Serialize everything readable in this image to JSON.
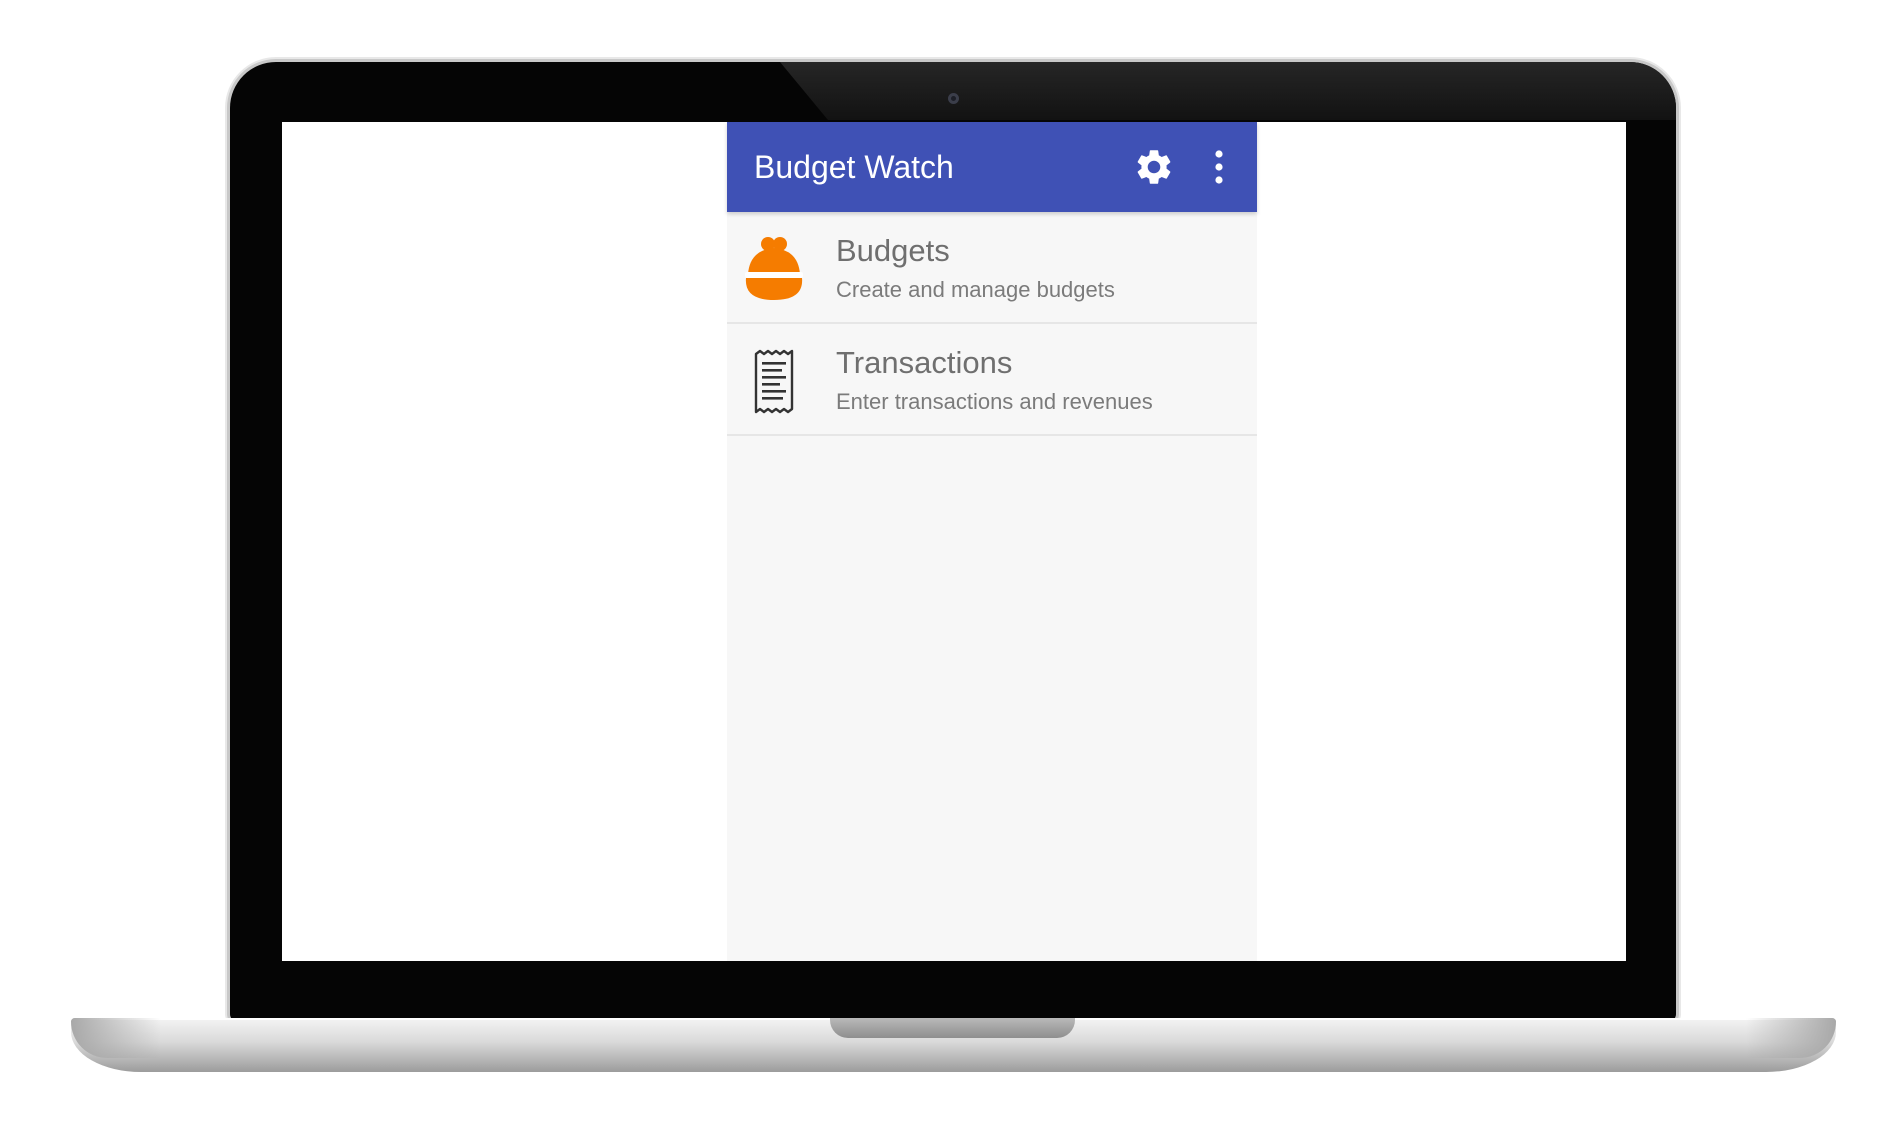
{
  "app": {
    "title": "Budget Watch",
    "colors": {
      "primary": "#3f51b5",
      "accent_orange": "#f57c00",
      "background": "#f7f7f7"
    },
    "toolbar": {
      "settings_icon": "gear-icon",
      "overflow_icon": "more-vertical-icon"
    }
  },
  "menu": {
    "items": [
      {
        "title": "Budgets",
        "subtitle": "Create and manage budgets",
        "icon": "coin-purse-icon"
      },
      {
        "title": "Transactions",
        "subtitle": "Enter transactions and revenues",
        "icon": "receipt-icon"
      }
    ]
  }
}
